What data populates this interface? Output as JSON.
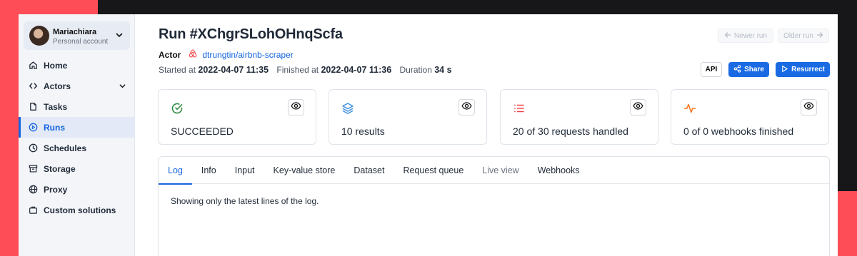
{
  "account": {
    "name": "Mariachiara",
    "subtitle": "Personal account"
  },
  "sidebar": {
    "items": [
      {
        "label": "Home",
        "icon": "home-icon"
      },
      {
        "label": "Actors",
        "icon": "code-icon"
      },
      {
        "label": "Tasks",
        "icon": "file-icon"
      },
      {
        "label": "Runs",
        "icon": "play-circle-icon"
      },
      {
        "label": "Schedules",
        "icon": "clock-icon"
      },
      {
        "label": "Storage",
        "icon": "archive-icon"
      },
      {
        "label": "Proxy",
        "icon": "globe-icon"
      },
      {
        "label": "Custom solutions",
        "icon": "briefcase-icon"
      }
    ]
  },
  "run": {
    "title": "Run #XChgrSLohOHnqScfa",
    "actor_label": "Actor",
    "actor_name": "dtrungtin/airbnb-scraper",
    "started_label": "Started at",
    "started_value": "2022-04-07 11:35",
    "finished_label": "Finished at",
    "finished_value": "2022-04-07 11:36",
    "duration_label": "Duration",
    "duration_value": "34 s"
  },
  "header_buttons": {
    "newer": "Newer run",
    "older": "Older run",
    "api": "API",
    "share": "Share",
    "resurrect": "Resurrect"
  },
  "cards": [
    {
      "text": "SUCCEEDED",
      "icon": "check-circle-icon"
    },
    {
      "text": "10 results",
      "icon": "layers-icon"
    },
    {
      "text": "20 of 30 requests handled",
      "icon": "list-icon"
    },
    {
      "text": "0 of 0 webhooks finished",
      "icon": "activity-icon"
    }
  ],
  "tabs": [
    "Log",
    "Info",
    "Input",
    "Key-value store",
    "Dataset",
    "Request queue",
    "Live view",
    "Webhooks"
  ],
  "log": {
    "message": "Showing only the latest lines of the log."
  },
  "colors": {
    "accent": "#1565e0",
    "success": "#2f8a3f",
    "dataset": "#3b8fe0",
    "requests": "#ef4444",
    "webhooks": "#f97316",
    "backdrop_red": "#ff4d57",
    "backdrop_dark": "#17171a"
  }
}
